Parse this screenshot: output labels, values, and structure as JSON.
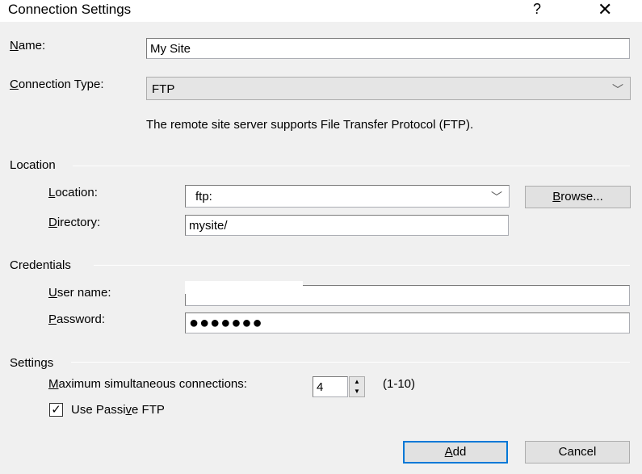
{
  "window": {
    "title": "Connection Settings",
    "help": "?",
    "close": "✕"
  },
  "name": {
    "label": "Name:",
    "value": "My Site"
  },
  "connection_type": {
    "label": "Connection Type:",
    "value": "FTP",
    "description": "The remote site server supports File Transfer Protocol (FTP)."
  },
  "location_group": {
    "title": "Location",
    "location_label": "Location:",
    "location_value": "ftp:",
    "directory_label": "Directory:",
    "directory_value": "mysite/",
    "browse": "Browse..."
  },
  "credentials": {
    "title": "Credentials",
    "user_label": "User name:",
    "password_label": "Password:",
    "password_value": "●●●●●●●"
  },
  "settings": {
    "title": "Settings",
    "max_label": "Maximum simultaneous connections:",
    "max_value": "4",
    "range": "(1-10)",
    "passive_pre": "Use Passi",
    "passive_key": "v",
    "passive_post": "e FTP",
    "passive_checked": true
  },
  "buttons": {
    "add": "Add",
    "cancel": "Cancel"
  },
  "colors": {
    "accent": "#0078d7",
    "background": "#f0f0f0"
  },
  "icons": {
    "dropdown": "chevron-down-icon",
    "check": "checkmark-icon"
  }
}
